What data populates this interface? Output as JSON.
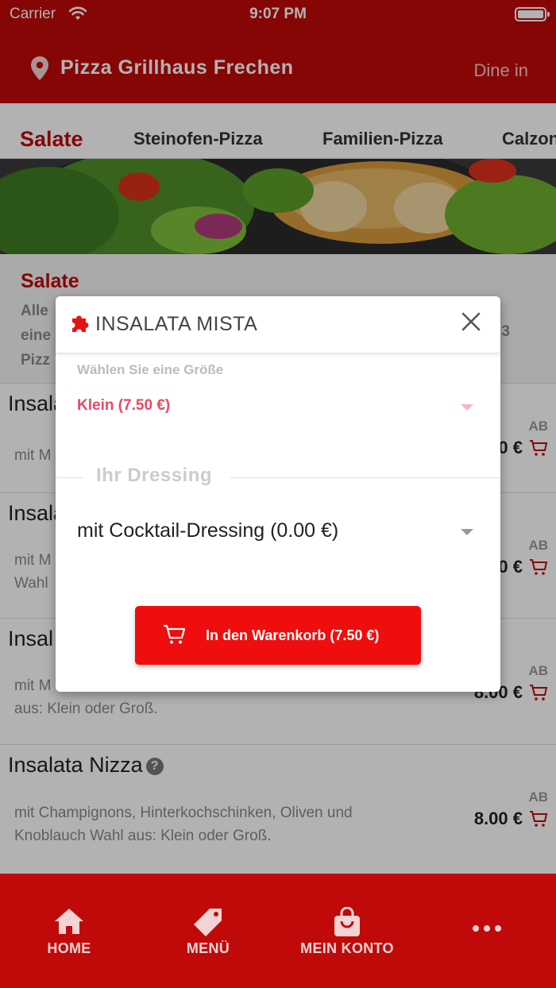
{
  "status_bar": {
    "carrier": "Carrier",
    "time": "9:07 PM"
  },
  "header": {
    "title": "Pizza Grillhaus Frechen",
    "mode": "Dine in"
  },
  "tabs": [
    {
      "label": "Salate",
      "active": true
    },
    {
      "label": "Steinofen-Pizza"
    },
    {
      "label": "Familien-Pizza"
    },
    {
      "label": "Calzon"
    }
  ],
  "category": {
    "title": "Salate",
    "description_lines": [
      "Alle",
      "eine",
      "Pizz"
    ],
    "desc_trailing": "3"
  },
  "items": [
    {
      "name": "Insala",
      "desc": "mit M",
      "ab": "AB",
      "price": "0 €"
    },
    {
      "name": "Insala",
      "desc": "mit M\nWahl",
      "ab": "AB",
      "price": "0 €"
    },
    {
      "name": "Insal",
      "desc": "mit M\naus: Klein oder Groß.",
      "ab": "AB",
      "price": "8.00 €"
    },
    {
      "name": "Insalata Nizza",
      "desc": "mit Champignons, Hinterkochschinken, Oliven und Knoblauch Wahl aus: Klein oder Groß.",
      "ab": "AB",
      "price": "8.00 €"
    }
  ],
  "modal": {
    "title": "INSALATA MISTA",
    "size_label": "Wählen Sie eine Größe",
    "size_value": "Klein (7.50 €)",
    "dressing_section": "Ihr Dressing",
    "dressing_value": "mit Cocktail-Dressing (0.00 €)",
    "add_button": "In den Warenkorb (7.50 €)"
  },
  "bottom_nav": [
    {
      "label": "HOME",
      "icon": "home-icon"
    },
    {
      "label": "MENÜ",
      "icon": "tag-icon"
    },
    {
      "label": "MEIN KONTO",
      "icon": "bag-icon"
    },
    {
      "label": "",
      "icon": "more-icon"
    }
  ],
  "colors": {
    "brand": "#c00a0a",
    "button": "#f00d0d",
    "accent_pink": "#e84a5f"
  }
}
